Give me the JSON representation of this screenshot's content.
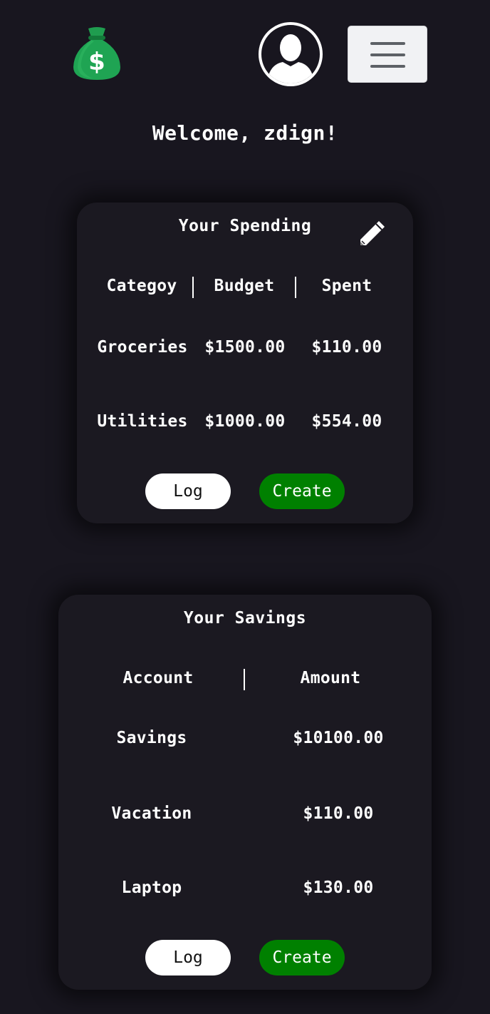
{
  "header": {
    "logo_icon": "money-bag-icon",
    "avatar_icon": "user-avatar-icon",
    "menu_icon": "hamburger-menu-icon",
    "welcome_text": "Welcome, zdign!"
  },
  "spending": {
    "title": "Your Spending",
    "edit_icon": "pencil-icon",
    "columns": [
      "Categoy",
      "Budget",
      "Spent"
    ],
    "rows": [
      {
        "category": "Groceries",
        "budget": "$1500.00",
        "spent": "$110.00"
      },
      {
        "category": "Utilities",
        "budget": "$1000.00",
        "spent": "$554.00"
      }
    ],
    "log_label": "Log",
    "create_label": "Create"
  },
  "savings": {
    "title": "Your Savings",
    "columns": [
      "Account",
      "Amount"
    ],
    "rows": [
      {
        "account": "Savings",
        "amount": "$10100.00"
      },
      {
        "account": "Vacation",
        "amount": "$110.00"
      },
      {
        "account": "Laptop",
        "amount": "$130.00"
      }
    ],
    "log_label": "Log",
    "create_label": "Create"
  },
  "colors": {
    "background": "#18161f",
    "card": "#1b1921",
    "create_button": "#008000",
    "log_button": "#ffffff",
    "logo_green": "#1e9e4e"
  }
}
